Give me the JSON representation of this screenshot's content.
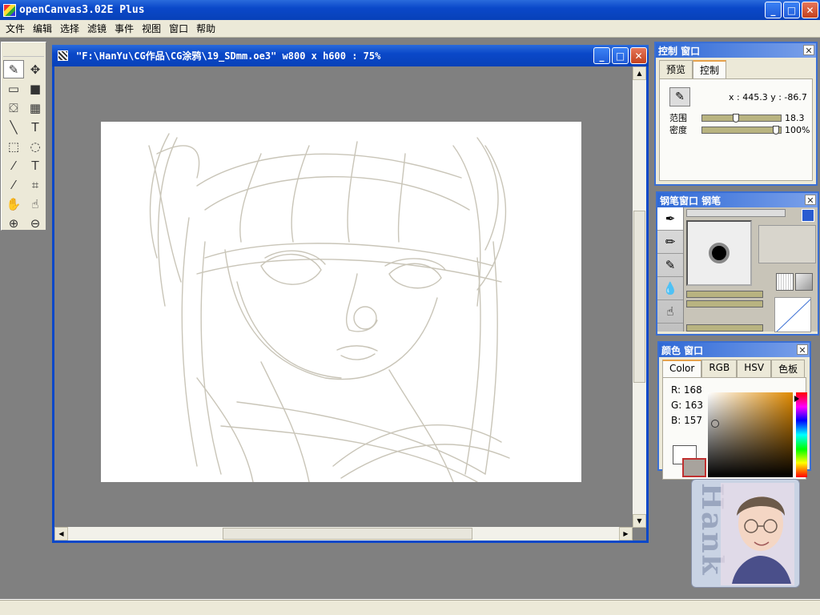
{
  "app": {
    "title": "openCanvas3.02E Plus",
    "window_controls": {
      "minimize": "_",
      "maximize": "□",
      "close": "✕"
    }
  },
  "menubar": {
    "items": [
      "文件",
      "编辑",
      "选择",
      "滤镜",
      "事件",
      "视图",
      "窗口",
      "帮助"
    ]
  },
  "toolbox": {
    "tools": [
      {
        "name": "pen-tool",
        "glyph": "✎"
      },
      {
        "name": "move-tool",
        "glyph": "✥"
      },
      {
        "name": "rect-outline-tool",
        "glyph": "▭"
      },
      {
        "name": "rect-fill-tool",
        "glyph": "■"
      },
      {
        "name": "fill-bucket-tool",
        "glyph": "⛋"
      },
      {
        "name": "gradient-tool",
        "glyph": "▦"
      },
      {
        "name": "line-tool",
        "glyph": "╲"
      },
      {
        "name": "text-tool",
        "glyph": "T"
      },
      {
        "name": "rect-select-tool",
        "glyph": "⬚"
      },
      {
        "name": "lasso-select-tool",
        "glyph": "◌"
      },
      {
        "name": "magic-wand-tool",
        "glyph": "⁄"
      },
      {
        "name": "text-select-tool",
        "glyph": "Ｔ"
      },
      {
        "name": "eyedropper-tool",
        "glyph": "⁄"
      },
      {
        "name": "crop-tool",
        "glyph": "⌗"
      },
      {
        "name": "hand-tool",
        "glyph": "✋"
      },
      {
        "name": "rotate-hand-tool",
        "glyph": "☝"
      },
      {
        "name": "zoom-in-tool",
        "glyph": "⊕"
      },
      {
        "name": "zoom-out-tool",
        "glyph": "⊖"
      }
    ]
  },
  "canvas_window": {
    "title": "\"F:\\HanYu\\CG作品\\CG涂鸦\\19_SDmm.oe3\" w800 x h600 : 75%"
  },
  "control_panel": {
    "title": "控制 窗口",
    "tabs": [
      "预览",
      "控制"
    ],
    "selected_tab": "控制",
    "coords": "x : 445.3   y : -86.7",
    "sliders": [
      {
        "label": "范围",
        "value": "18.3",
        "level": 0.4
      },
      {
        "label": "密度",
        "value": "100%",
        "level": 0.95
      }
    ]
  },
  "pen_panel": {
    "title": "钢笔窗口   钢笔"
  },
  "color_panel": {
    "title": "颜色 窗口",
    "tabs": [
      "Color",
      "RGB",
      "HSV",
      "色板"
    ],
    "selected_tab": "Color",
    "r": "R: 168",
    "g": "G: 163",
    "b": "B: 157",
    "current_color": "#a8a39d"
  },
  "avatar": {
    "signature": "Hank"
  }
}
